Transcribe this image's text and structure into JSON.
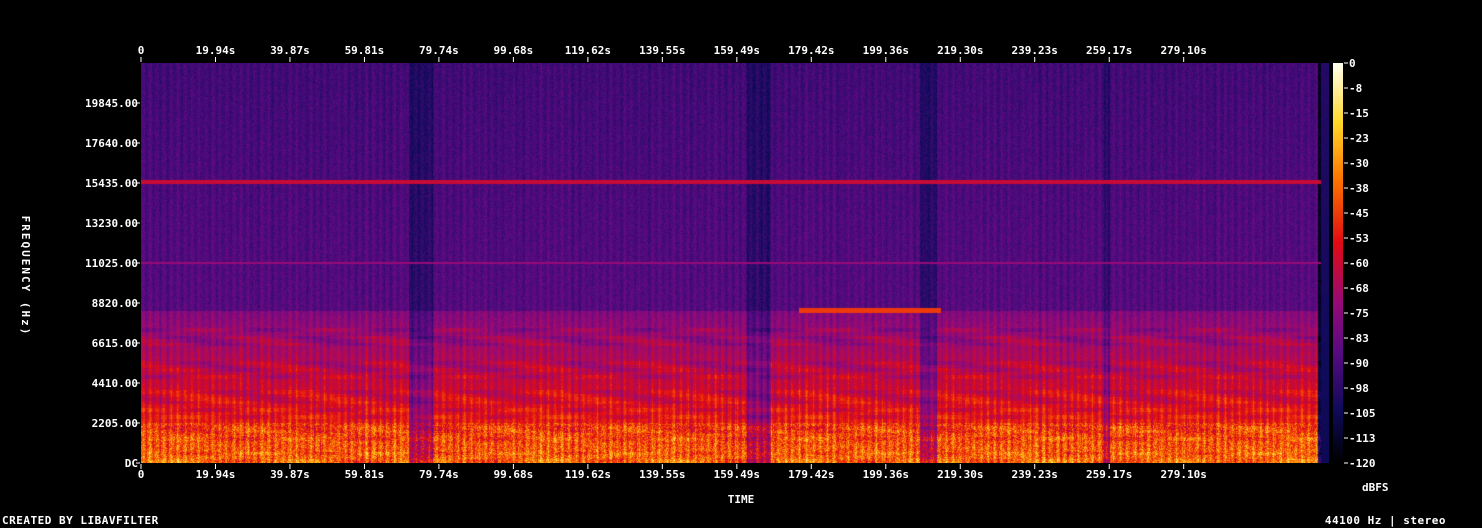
{
  "chart_data": {
    "type": "heatmap",
    "subtype": "spectrogram",
    "xlabel": "TIME",
    "ylabel": "FREQUENCY (Hz)",
    "x_ticks": [
      "0",
      "19.94s",
      "39.87s",
      "59.81s",
      "79.74s",
      "99.68s",
      "119.62s",
      "139.55s",
      "159.49s",
      "179.42s",
      "199.36s",
      "219.30s",
      "239.23s",
      "259.17s",
      "279.10s"
    ],
    "x_tick_values": [
      0,
      19.94,
      39.87,
      59.81,
      79.74,
      99.68,
      119.62,
      139.55,
      159.49,
      179.42,
      199.36,
      219.3,
      239.23,
      259.17,
      279.1
    ],
    "xlim": [
      0,
      318
    ],
    "y_ticks": [
      "DC",
      "2205.00",
      "4410.00",
      "6615.00",
      "8820.00",
      "11025.00",
      "13230.00",
      "15435.00",
      "17640.00",
      "19845.00"
    ],
    "y_tick_values": [
      0,
      2205,
      4410,
      6615,
      8820,
      11025,
      13230,
      15435,
      17640,
      19845
    ],
    "ylim": [
      0,
      22050
    ],
    "colorbar": {
      "label": "dBFS",
      "ticks": [
        "0",
        "-8",
        "-15",
        "-23",
        "-30",
        "-38",
        "-45",
        "-53",
        "-60",
        "-68",
        "-75",
        "-83",
        "-90",
        "-98",
        "-105",
        "-113",
        "-120"
      ],
      "range": [
        -120,
        0
      ]
    },
    "features": {
      "horizontal_lines_hz": [
        15500,
        11025
      ],
      "tone_band_hz": 8400,
      "tone_band_time": [
        176,
        214
      ]
    }
  },
  "footer": {
    "left": "CREATED BY LIBAVFILTER",
    "right": "44100 Hz | stereo"
  },
  "colors": {
    "background": "#000000",
    "text": "#ffffff"
  }
}
